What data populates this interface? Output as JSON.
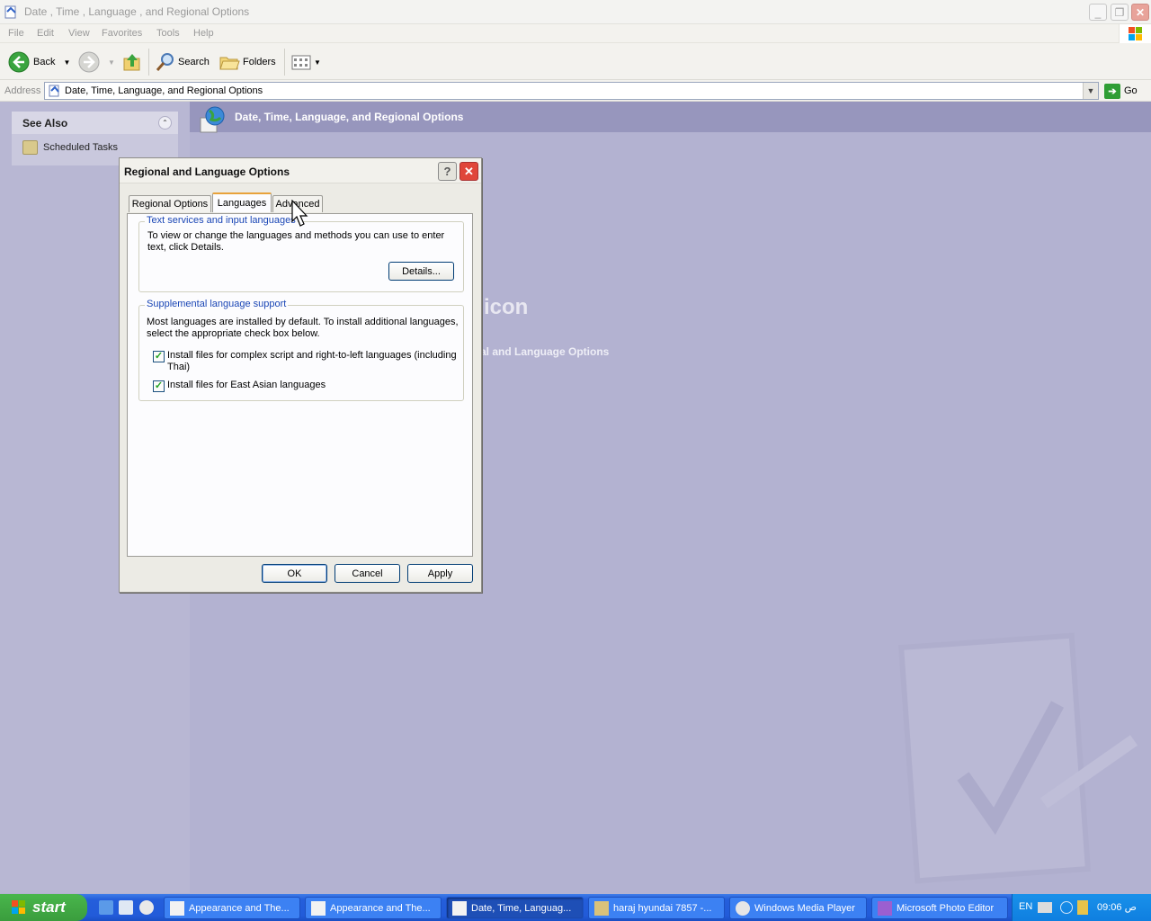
{
  "window": {
    "title": "Date , Time , Language , and Regional Options"
  },
  "menubar": {
    "items": [
      "File",
      "Edit",
      "View",
      "Favorites",
      "Tools",
      "Help"
    ]
  },
  "toolbar": {
    "back_label": "Back",
    "search_label": "Search",
    "folders_label": "Folders"
  },
  "address": {
    "label": "Address",
    "value": "Date, Time, Language, and Regional Options",
    "go_label": "Go"
  },
  "see_also": {
    "title": "See Also",
    "items": [
      "Scheduled Tasks"
    ]
  },
  "content": {
    "header_title": "Date, Time, Language, and Regional Options",
    "partial_heading": "icon",
    "partial_link": "al and Language Options"
  },
  "dialog": {
    "title": "Regional and Language Options",
    "tabs": [
      "Regional Options",
      "Languages",
      "Advanced"
    ],
    "active_tab": "Languages",
    "text_services": {
      "title": "Text services and input languages",
      "line1": "To view or change the languages and methods you can use to enter",
      "line2": "text, click Details.",
      "details_label": "Details..."
    },
    "supplemental": {
      "title": "Supplemental language support",
      "line1": "Most languages are installed by default. To install additional languages,",
      "line2": "select the appropriate check box below.",
      "checkbox1_line1": "Install files for complex script and right-to-left languages (including",
      "checkbox1_line2": "Thai)",
      "checkbox1_checked": true,
      "checkbox2": "Install files for East Asian languages",
      "checkbox2_checked": true
    },
    "buttons": {
      "ok": "OK",
      "cancel": "Cancel",
      "apply": "Apply"
    }
  },
  "taskbar": {
    "start_label": "start",
    "tasks": [
      "Appearance and The...",
      "Appearance and The...",
      "Date, Time, Languag...",
      "haraj hyundai 7857 -...",
      "Windows Media Player",
      "Microsoft Photo Editor"
    ],
    "active_task": 2,
    "tray_lang": "EN",
    "clock": "09:06 ص"
  },
  "colors": {
    "accent": "#245edb",
    "start_green": "#3a9d3d",
    "group_title_blue": "#1a46b5",
    "content_bg": "#b3b2d1"
  }
}
